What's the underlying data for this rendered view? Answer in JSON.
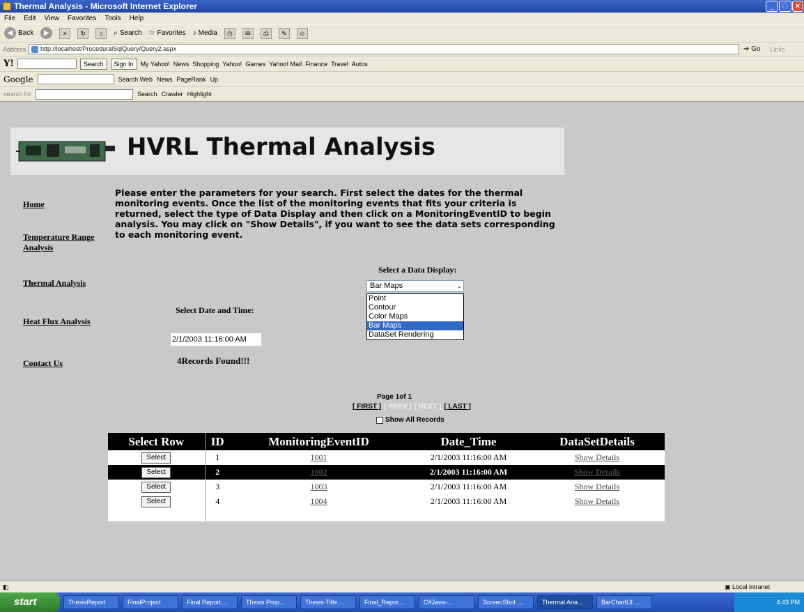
{
  "window": {
    "title": "Thermal Analysis - Microsoft Internet Explorer"
  },
  "menu": [
    "File",
    "Edit",
    "View",
    "Favorites",
    "Tools",
    "Help"
  ],
  "toolbar": {
    "back": "Back",
    "search": "Search",
    "favorites": "Favorites",
    "media": "Media"
  },
  "address": {
    "label": "Address",
    "url": "http://localhost/ProceduralSqlQuery/Query2.aspx",
    "go": "Go",
    "links": "Links"
  },
  "yahoo_bar": {
    "search_btn": "Search",
    "sign_in": "Sign In",
    "items": [
      "My Yahoo!",
      "News",
      "Shopping",
      "Yahoo!",
      "Games",
      "Yahoo! Mail",
      "Finance",
      "Travel",
      "Autos"
    ]
  },
  "google_bar": {
    "label": "Google",
    "search_web": "Search Web",
    "news": "News",
    "pagerank": "PageRank",
    "up": "Up"
  },
  "search_bar": {
    "label": "search for",
    "search": "Search",
    "crawler": "Crawler",
    "highlight": "Highlight"
  },
  "page": {
    "title": "HVRL Thermal Analysis",
    "nav": [
      "Home",
      "Temperature Range Analysis",
      "Thermal Analysis",
      "Heat Flux Analysis",
      "Contact Us"
    ],
    "instructions": "Please enter the parameters for your search. First select the dates for the thermal monitoring events. Once the list of the monitoring events that fits your criteria is returned, select the type of Data Display and then click on a MonitoringEventID to begin analysis. You may click on \"Show Details\", if you want to see the data sets corresponding to each monitoring event.",
    "display_label": "Select a Data Display:",
    "display_selected": "Bar Maps",
    "display_options": [
      "Point",
      "Contour",
      "Color Maps",
      "Bar Maps",
      "DataSet Rendering"
    ],
    "date_label": "Select Date and Time:",
    "date_value": "2/1/2003 11:16:00 AM",
    "records_found": "4Records Found!!!",
    "page_info": "Page 1of 1",
    "pager": {
      "first": "[ FIRST ]",
      "prev": "[ PREV ]",
      "next": "[ NEXT ]",
      "last": "[ LAST ]"
    },
    "show_all": "Show All Records"
  },
  "grid": {
    "headers": [
      "Select Row",
      "ID",
      "MonitoringEventID",
      "Date_Time",
      "DataSetDetails"
    ],
    "rows": [
      {
        "select": "Select",
        "id": "1",
        "event": "1001",
        "date": "2/1/2003 11:16:00 AM",
        "details": "Show Details"
      },
      {
        "select": "Select",
        "id": "2",
        "event": "1002",
        "date": "2/1/2003 11:16:00 AM",
        "details": "Show Details"
      },
      {
        "select": "Select",
        "id": "3",
        "event": "1003",
        "date": "2/1/2003 11:16:00 AM",
        "details": "Show Details"
      },
      {
        "select": "Select",
        "id": "4",
        "event": "1004",
        "date": "2/1/2003 11:16:00 AM",
        "details": "Show Details"
      }
    ]
  },
  "status": {
    "zone": "Local intranet"
  },
  "taskbar": {
    "start": "start",
    "tasks": [
      "ThesisReport",
      "FinalProject",
      "Final Report...",
      "Thesis Prop...",
      "Thesis-Title ...",
      "Final_Repor...",
      "C#Java-...",
      "ScreenShot ...",
      "Thermal Ana...",
      "BarChartUI ..."
    ],
    "clock": "4:43 PM"
  }
}
